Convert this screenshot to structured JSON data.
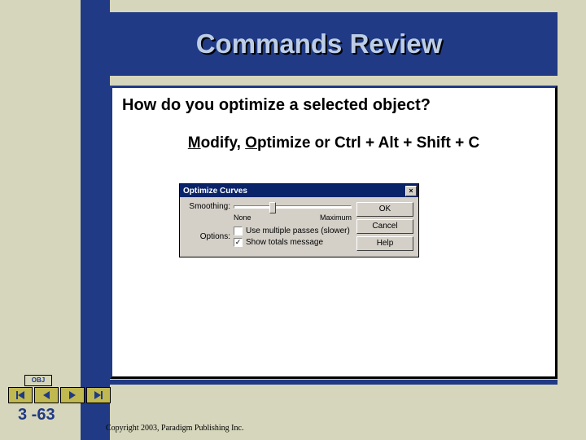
{
  "title": "Commands Review",
  "question": "How do you optimize a selected object?",
  "answer": {
    "prefix_m": "M",
    "modify_rest": "odify, ",
    "prefix_o": "O",
    "optimize_rest": "ptimize or Ctrl + Alt + Shift + C"
  },
  "dialog": {
    "title": "Optimize Curves",
    "smoothing": "Smoothing:",
    "none": "None",
    "maximum": "Maximum",
    "options": "Options:",
    "use_multiple": "Use multiple passes (slower)",
    "show_totals": "Show totals message",
    "ok": "OK",
    "cancel": "Cancel",
    "help": "Help",
    "close": "×"
  },
  "obj_label": "OBJ",
  "page_number": "3 -63",
  "copyright": "Copyright 2003, Paradigm Publishing Inc."
}
